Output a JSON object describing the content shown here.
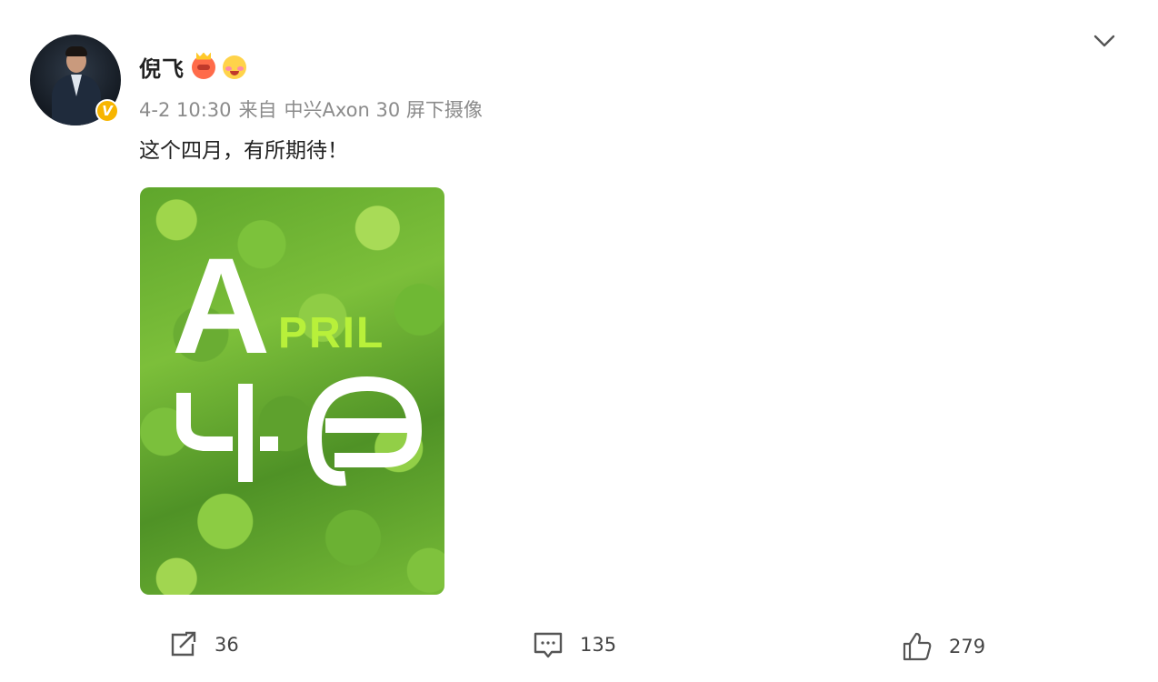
{
  "post": {
    "author": "倪飞",
    "badges": [
      "crown-emoji",
      "shy-emoji"
    ],
    "verified_mark": "V",
    "date": "4-2 10:30",
    "source_prefix": "来自",
    "source": "中兴Axon 30 屏下摄像",
    "text": "这个四月，有所期待！"
  },
  "image": {
    "word": "PRIL",
    "letter_big": "A",
    "month_glyph": "四月",
    "accent_color": "#b8f03a"
  },
  "actions": {
    "repost_count": "36",
    "comment_count": "135",
    "like_count": "279"
  },
  "colors": {
    "verified_badge": "#f7b500",
    "meta_text": "#8b8b8b"
  }
}
